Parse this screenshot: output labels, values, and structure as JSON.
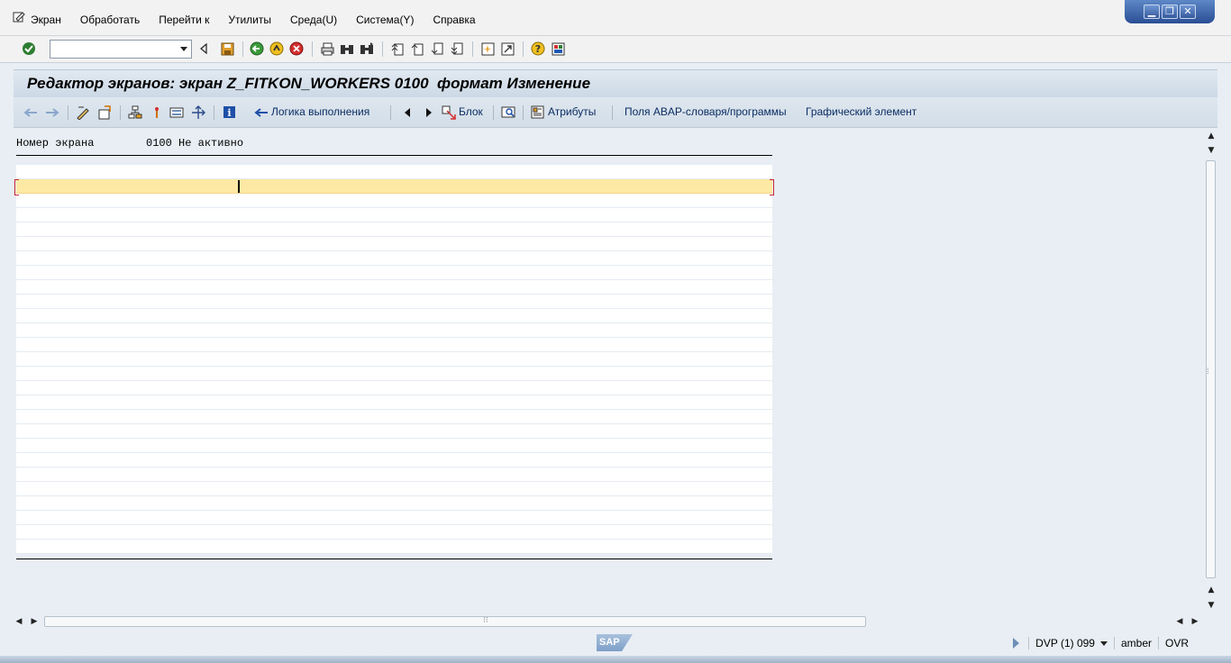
{
  "menu": {
    "items": [
      "Экран",
      "Обработать",
      "Перейти к",
      "Утилиты",
      "Среда(U)",
      "Система(Y)",
      "Справка"
    ]
  },
  "window_controls": {
    "minimize": "▁",
    "restore": "❐",
    "close": "✕"
  },
  "toolbar": {
    "command_field_value": ""
  },
  "title": "Редактор экранов: экран Z_FITKON_WORKERS 0100  формат Изменение",
  "app_toolbar": {
    "flow_logic": "Логика выполнения",
    "block": "Блок",
    "attributes": "Атрибуты",
    "dict_fields": "Поля ABAP-словаря/программы",
    "graphic_element": "Графический элемент"
  },
  "screen_info": {
    "label": "Номер экрана",
    "number": "0100",
    "status": "Не активно"
  },
  "statusbar": {
    "system": "DVP (1) 099",
    "server": "amber",
    "mode": "OVR",
    "logo": "SAP"
  }
}
